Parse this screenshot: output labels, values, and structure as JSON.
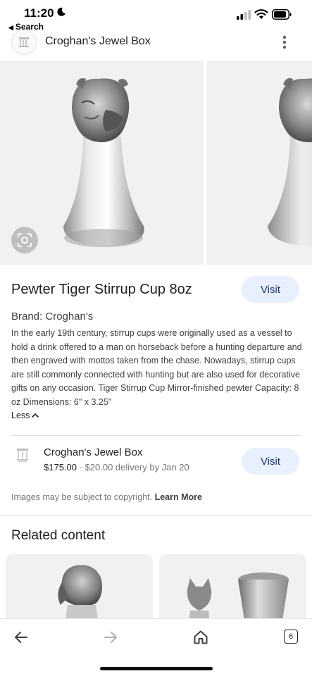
{
  "status_bar": {
    "time": "11:20",
    "back_app_label": "Search"
  },
  "header": {
    "site_name": "Croghan's Jewel Box",
    "menu_icon": "more-vert-icon"
  },
  "product": {
    "title": "Pewter Tiger Stirrup Cup 8oz",
    "visit_label": "Visit",
    "brand": "Brand: Croghan's",
    "description": "In the early 19th century, stirrup cups were originally used as a vessel to hold a drink offered to a man on horseback before a hunting departure and then engraved with mottos taken from the chase. Nowadays, stirrup cups are still commonly connected with hunting but are also used for decorative gifts on any occasion. Tiger Stirrup Cup Mirror-finished pewter Capacity: 8 oz Dimensions: 6\" x 3.25\"",
    "less_label": "Less"
  },
  "seller": {
    "name": "Croghan's Jewel Box",
    "price": "$175.00",
    "delivery": " · $20.00 delivery by Jan 20",
    "visit_label": "Visit"
  },
  "copyright": {
    "text": "Images may be subject to copyright. ",
    "link": "Learn More"
  },
  "related": {
    "title": "Related content"
  },
  "bottom_nav": {
    "tab_count": "6"
  },
  "colors": {
    "visit_button_bg": "#e8f0fe",
    "visit_button_text": "#1a3a6b",
    "image_bg": "#f1f1f1"
  }
}
